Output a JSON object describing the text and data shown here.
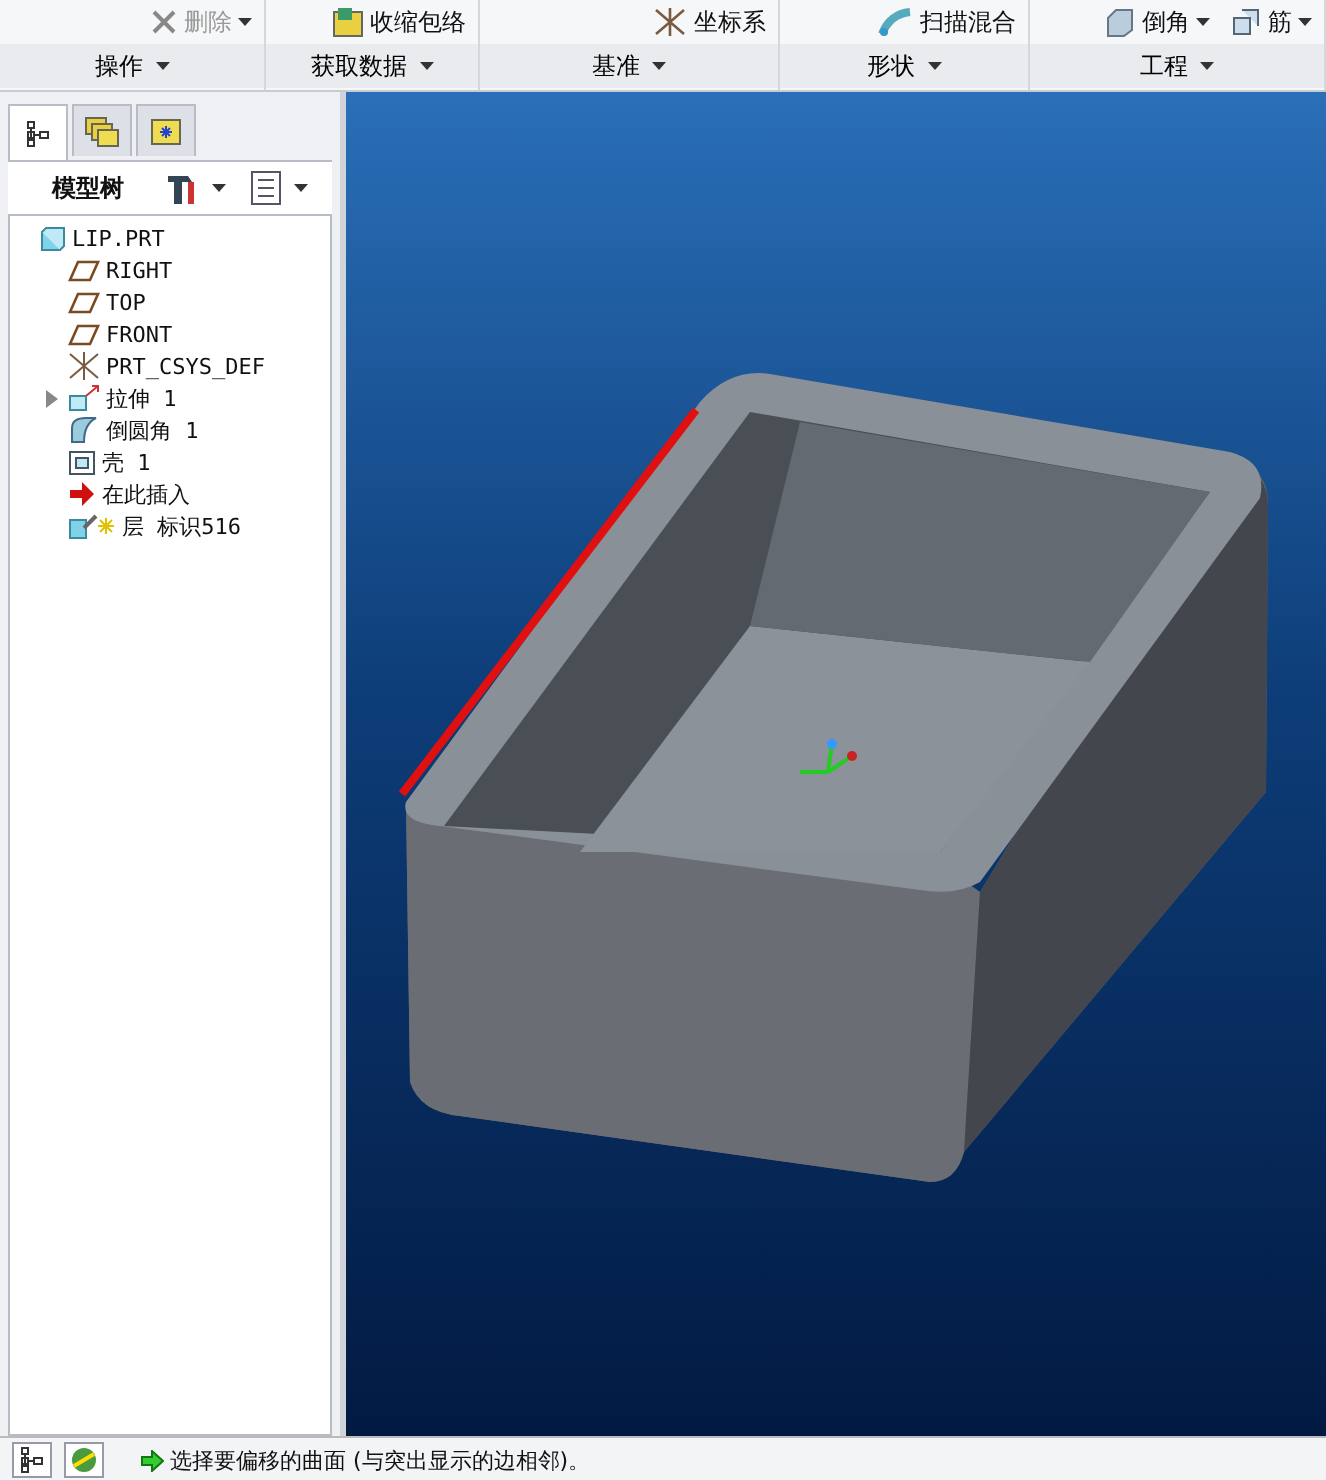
{
  "ribbon": {
    "groups": [
      {
        "label": "操作",
        "items": [
          {
            "label": "删除",
            "disabled": true,
            "dropdown": true
          }
        ]
      },
      {
        "label": "获取数据",
        "items": [
          {
            "label": "收缩包络",
            "disabled": false,
            "dropdown": false
          }
        ]
      },
      {
        "label": "基准",
        "items": [
          {
            "label": "坐标系",
            "disabled": false,
            "dropdown": false
          }
        ]
      },
      {
        "label": "形状",
        "items": [
          {
            "label": "扫描混合",
            "disabled": false,
            "dropdown": false
          }
        ]
      },
      {
        "label": "工程",
        "items": [
          {
            "label": "倒角",
            "disabled": false,
            "dropdown": true
          },
          {
            "label": "筋",
            "disabled": false,
            "dropdown": true
          }
        ]
      }
    ]
  },
  "panel": {
    "tabs": [
      {
        "selected": true
      },
      {
        "selected": false
      },
      {
        "selected": false
      }
    ],
    "title": "模型树",
    "tree": [
      {
        "label": "LIP.PRT",
        "kind": "part",
        "children": [
          {
            "label": "RIGHT",
            "kind": "plane"
          },
          {
            "label": "TOP",
            "kind": "plane"
          },
          {
            "label": "FRONT",
            "kind": "plane"
          },
          {
            "label": "PRT_CSYS_DEF",
            "kind": "csys"
          },
          {
            "label": "拉伸 1",
            "kind": "extrude",
            "expanded": false
          },
          {
            "label": "倒圆角 1",
            "kind": "round"
          },
          {
            "label": "壳 1",
            "kind": "shell"
          },
          {
            "label": "在此插入",
            "kind": "insert"
          },
          {
            "label": "层 标识516",
            "kind": "layer"
          }
        ]
      }
    ]
  },
  "status_bar": {
    "message": "选择要偏移的曲面 (与突出显示的边相邻)。"
  }
}
